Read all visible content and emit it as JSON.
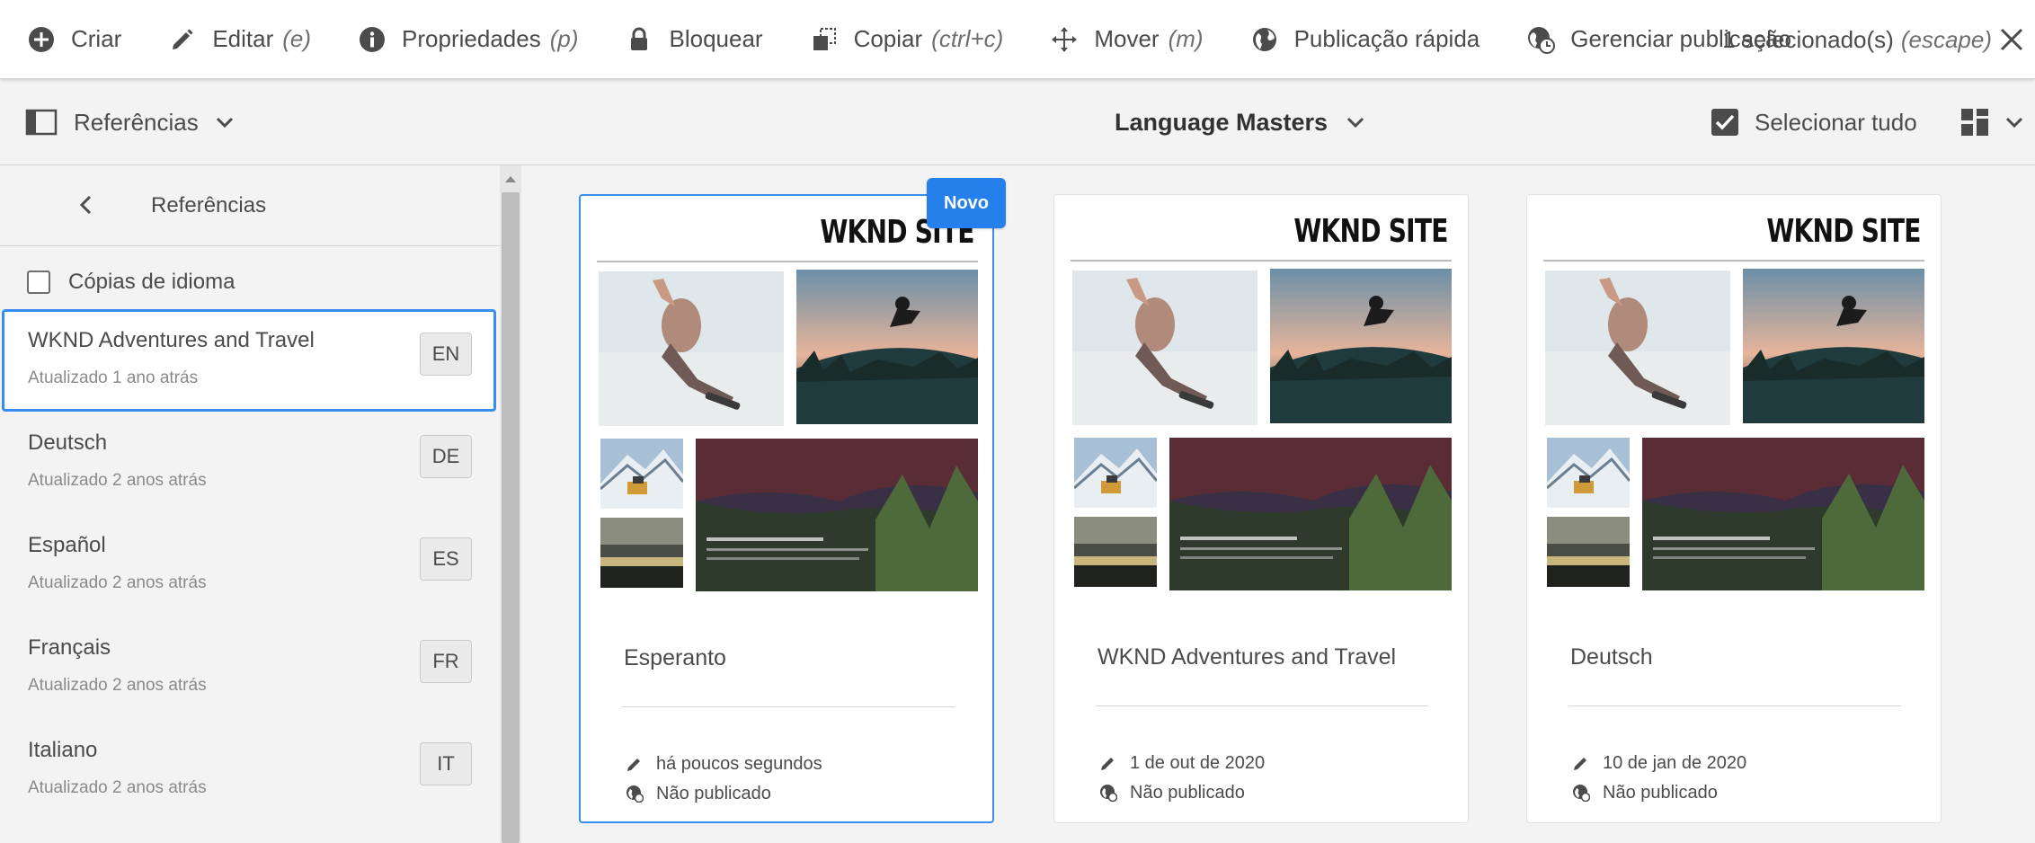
{
  "actionbar": {
    "actions": [
      {
        "label": "Criar",
        "shortcut": ""
      },
      {
        "label": "Editar",
        "shortcut": "(e)"
      },
      {
        "label": "Propriedades",
        "shortcut": "(p)"
      },
      {
        "label": "Bloquear",
        "shortcut": ""
      },
      {
        "label": "Copiar",
        "shortcut": "(ctrl+c)"
      },
      {
        "label": "Mover",
        "shortcut": "(m)"
      },
      {
        "label": "Publicação rápida",
        "shortcut": ""
      },
      {
        "label": "Gerenciar publicação",
        "shortcut": ""
      }
    ],
    "selection": {
      "label": "1 selecionado(s)",
      "shortcut": "(escape)"
    }
  },
  "titlebar": {
    "rail_label": "Referências",
    "context_title": "Language Masters",
    "select_all": "Selecionar tudo"
  },
  "rail": {
    "title": "Referências",
    "language_copies": "Cópias de idioma",
    "items": [
      {
        "name": "WKND Adventures and Travel",
        "updated": "Atualizado 1 ano atrás",
        "code": "EN"
      },
      {
        "name": "Deutsch",
        "updated": "Atualizado 2 anos atrás",
        "code": "DE"
      },
      {
        "name": "Español",
        "updated": "Atualizado 2 anos atrás",
        "code": "ES"
      },
      {
        "name": "Français",
        "updated": "Atualizado 2 anos atrás",
        "code": "FR"
      },
      {
        "name": "Italiano",
        "updated": "Atualizado 2 anos atrás",
        "code": "IT"
      }
    ]
  },
  "cards": [
    {
      "title": "Esperanto",
      "badge": "Novo",
      "modified": "há poucos segundos",
      "status": "Não publicado",
      "site_logo": "WKND SITE"
    },
    {
      "title": "WKND Adventures and Travel",
      "badge": "",
      "modified": "1 de out de 2020",
      "status": "Não publicado",
      "site_logo": "WKND SITE"
    },
    {
      "title": "Deutsch",
      "badge": "",
      "modified": "10 de jan de 2020",
      "status": "Não publicado",
      "site_logo": "WKND SITE"
    }
  ],
  "colors": {
    "accent": "#378ef0",
    "badge": "#2680eb",
    "text": "#4b4b4b",
    "background": "#f3f3f3"
  }
}
